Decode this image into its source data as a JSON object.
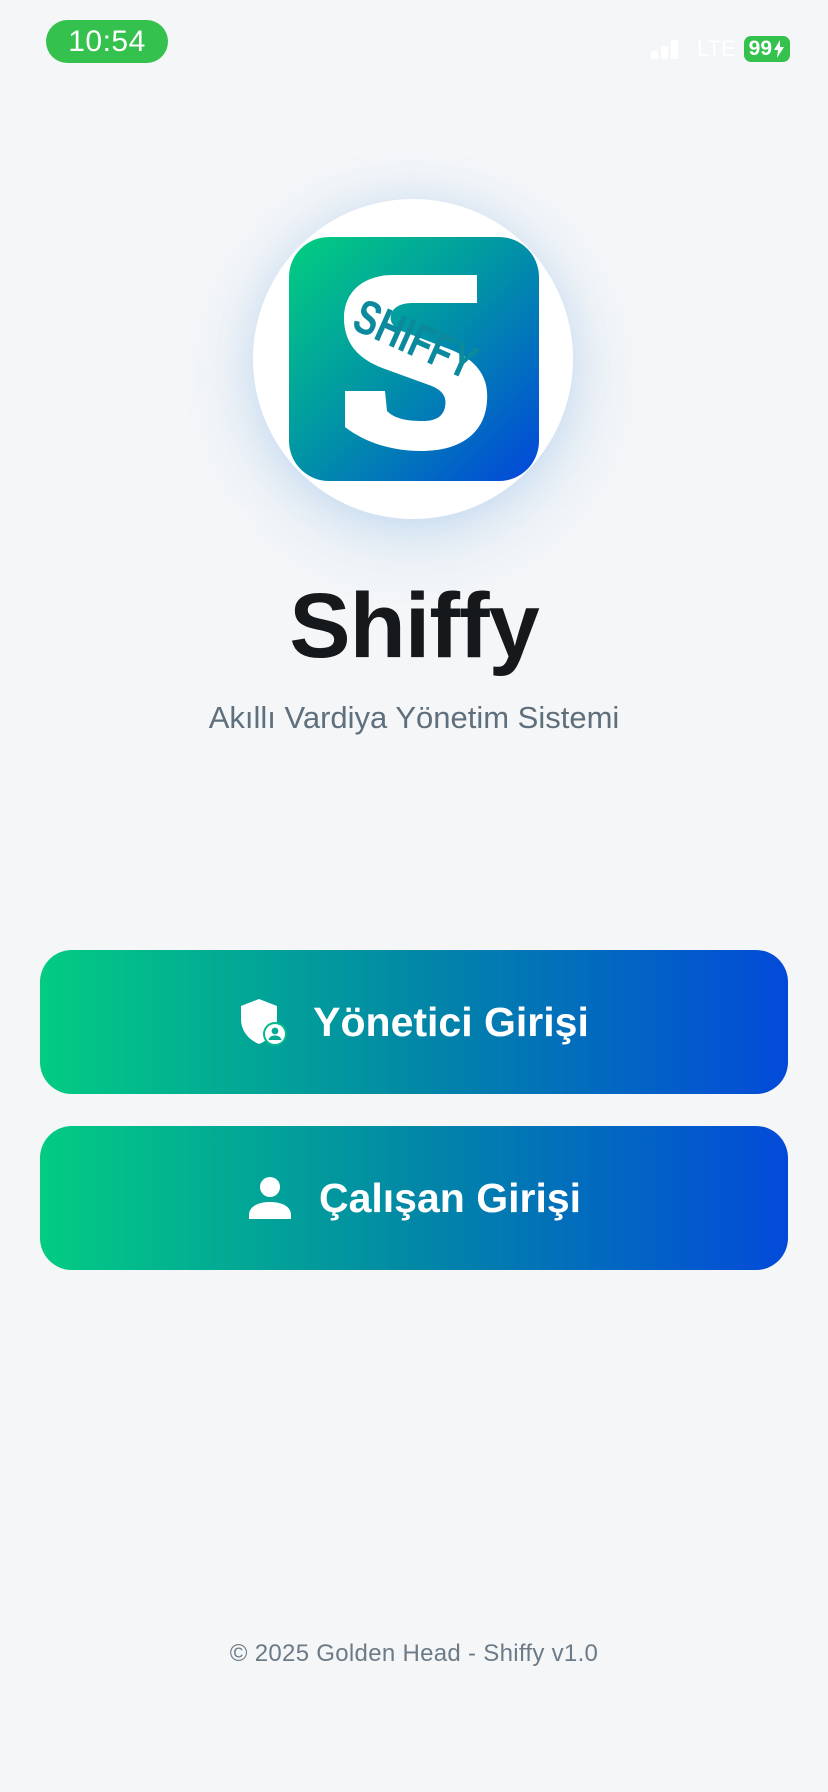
{
  "status_bar": {
    "time": "10:54",
    "network": "LTE",
    "battery": "99"
  },
  "logo": {
    "text": "SHIFFY",
    "icon": "shiffy-s-logo",
    "gradient_colors": [
      "#02cf7f",
      "#0190a8",
      "#0346dc"
    ]
  },
  "app": {
    "title": "Shiffy",
    "subtitle": "Akıllı Vardiya Yönetim Sistemi"
  },
  "buttons": {
    "admin": {
      "label": "Yönetici Girişi",
      "icon": "shield-user-icon"
    },
    "employee": {
      "label": "Çalışan Girişi",
      "icon": "person-icon"
    }
  },
  "footer": {
    "text": "© 2025 Golden Head - Shiffy v1.0"
  },
  "colors": {
    "background": "#f4f6f8",
    "status_green": "#34c14d",
    "title": "#15191c",
    "subtitle": "#5f6f7c"
  }
}
